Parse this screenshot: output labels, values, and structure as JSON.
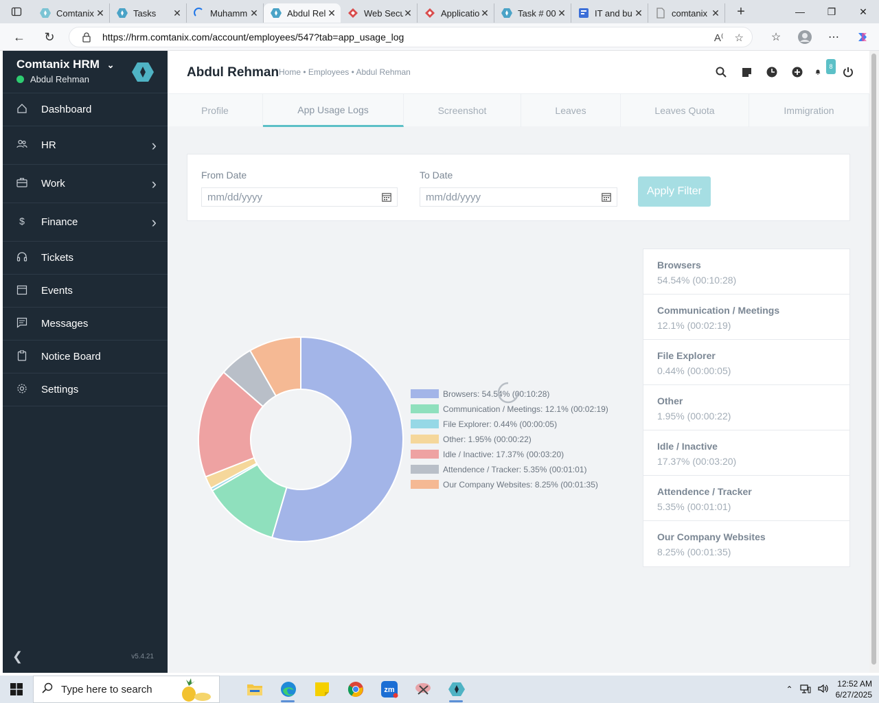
{
  "browser": {
    "tabs": [
      {
        "title": "Comtanix",
        "icon": "comtanix-icon",
        "color": "#7cc4d4",
        "active": false
      },
      {
        "title": "Tasks",
        "icon": "comtanix-icon",
        "color": "#4aa3c7",
        "active": false
      },
      {
        "title": "Muhamm",
        "icon": "loading-icon",
        "color": "#1a73e8",
        "active": false
      },
      {
        "title": "Abdul Rel",
        "icon": "comtanix-icon",
        "color": "#4aa3c7",
        "active": true
      },
      {
        "title": "Web Secu",
        "icon": "jira-icon",
        "color": "#d94c4c",
        "active": false
      },
      {
        "title": "Applicatio",
        "icon": "jira-icon",
        "color": "#d94c4c",
        "active": false
      },
      {
        "title": "Task # 00",
        "icon": "comtanix-icon",
        "color": "#4aa3c7",
        "active": false
      },
      {
        "title": "IT and bu",
        "icon": "doc-icon",
        "color": "#3c6fd8",
        "active": false
      },
      {
        "title": "comtanix",
        "icon": "page-icon",
        "color": "#888888",
        "active": false
      }
    ],
    "url": "https://hrm.comtanix.com/account/employees/547?tab=app_usage_log"
  },
  "sidebar": {
    "brand": "Comtanix HRM",
    "user": "Abdul Rehman",
    "items": [
      {
        "label": "Dashboard",
        "icon": "home-icon",
        "chevron": false
      },
      {
        "label": "HR",
        "icon": "users-icon",
        "chevron": true
      },
      {
        "label": "Work",
        "icon": "briefcase-icon",
        "chevron": true
      },
      {
        "label": "Finance",
        "icon": "dollar-icon",
        "chevron": true
      },
      {
        "label": "Tickets",
        "icon": "headset-icon",
        "chevron": false
      },
      {
        "label": "Events",
        "icon": "calendar-icon",
        "chevron": false
      },
      {
        "label": "Messages",
        "icon": "message-icon",
        "chevron": false
      },
      {
        "label": "Notice Board",
        "icon": "clipboard-icon",
        "chevron": false
      },
      {
        "label": "Settings",
        "icon": "gear-icon",
        "chevron": false
      }
    ],
    "version": "v5.4.21"
  },
  "header": {
    "title": "Abdul Rehman",
    "breadcrumb": "Home • Employees • Abdul Rehman",
    "notification_count": "8"
  },
  "tabs": [
    "Profile",
    "App Usage Logs",
    "Screenshot",
    "Leaves",
    "Leaves Quota",
    "Immigration"
  ],
  "filter": {
    "from_label": "From Date",
    "to_label": "To Date",
    "from_placeholder": "mm/dd/yyyy",
    "to_placeholder": "mm/dd/yyyy",
    "apply": "Apply Filter"
  },
  "chart_data": {
    "type": "pie",
    "title": "",
    "categories": [
      "Browsers",
      "Communication / Meetings",
      "File Explorer",
      "Other",
      "Idle / Inactive",
      "Attendence / Tracker",
      "Our Company Websites"
    ],
    "values": [
      54.54,
      12.1,
      0.44,
      1.95,
      17.37,
      5.35,
      8.25
    ],
    "durations": [
      "00:10:28",
      "00:02:19",
      "00:00:05",
      "00:00:22",
      "00:03:20",
      "00:01:01",
      "00:01:35"
    ],
    "legend_labels": [
      "Browsers: 54.54% (00:10:28)",
      "Communication / Meetings: 12.1% (00:02:19)",
      "File Explorer: 0.44% (00:00:05)",
      "Other: 1.95% (00:00:22)",
      "Idle / Inactive: 17.37% (00:03:20)",
      "Attendence / Tracker: 5.35% (00:01:01)",
      "Our Company Websites: 8.25% (00:01:35)"
    ],
    "colors": [
      "#a3b5e8",
      "#8fe0bd",
      "#96d8e6",
      "#f5d79b",
      "#eea2a2",
      "#b9bfc8",
      "#f5b994"
    ],
    "legend_position": "right",
    "style": "doughnut"
  },
  "usage_list": [
    {
      "name": "Browsers",
      "value": "54.54% (00:10:28)"
    },
    {
      "name": "Communication / Meetings",
      "value": "12.1% (00:02:19)"
    },
    {
      "name": "File Explorer",
      "value": "0.44% (00:00:05)"
    },
    {
      "name": "Other",
      "value": "1.95% (00:00:22)"
    },
    {
      "name": "Idle / Inactive",
      "value": "17.37% (00:03:20)"
    },
    {
      "name": "Attendence / Tracker",
      "value": "5.35% (00:01:01)"
    },
    {
      "name": "Our Company Websites",
      "value": "8.25% (00:01:35)"
    }
  ],
  "taskbar": {
    "search_placeholder": "Type here to search",
    "time": "12:52 AM",
    "date": "6/27/2025"
  }
}
